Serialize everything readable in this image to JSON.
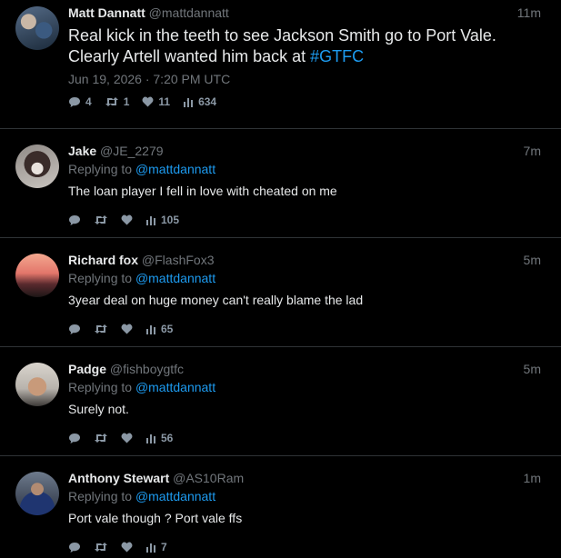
{
  "main_tweet": {
    "name": "Matt Dannatt",
    "handle": "@mattdannatt",
    "time": "11m",
    "text_part1": "Real kick in the teeth to see Jackson Smith go to Port Vale. Clearly Artell wanted him back at ",
    "hashtag": "#GTFC",
    "date": "Jun 19, 2026 · 7:20 PM UTC",
    "stats": {
      "replies": "4",
      "retweets": "1",
      "likes": "11",
      "views": "634"
    }
  },
  "replies": [
    {
      "name": "Jake",
      "handle": "@JE_2279",
      "time": "7m",
      "replying_prefix": "Replying to ",
      "replying_to": "@mattdannatt",
      "text": "The loan player I fell in love with cheated on me",
      "views": "105"
    },
    {
      "name": "Richard fox",
      "handle": "@FlashFox3",
      "time": "5m",
      "replying_prefix": "Replying to ",
      "replying_to": "@mattdannatt",
      "text": "3year deal on huge money can't really blame the lad",
      "views": "65"
    },
    {
      "name": "Padge",
      "handle": "@fishboygtfc",
      "time": "5m",
      "replying_prefix": "Replying to ",
      "replying_to": "@mattdannatt",
      "text": "Surely not.",
      "views": "56"
    },
    {
      "name": "Anthony Stewart",
      "handle": "@AS10Ram",
      "time": "1m",
      "replying_prefix": "Replying to ",
      "replying_to": "@mattdannatt",
      "text": "Port vale though ? Port vale ffs",
      "views": "7"
    }
  ],
  "colors": {
    "background": "#000000",
    "text": "#e7e9ea",
    "muted": "#71767b",
    "link": "#1d9bf0"
  },
  "icons": [
    "comment-icon",
    "retweet-icon",
    "heart-icon",
    "views-icon"
  ]
}
